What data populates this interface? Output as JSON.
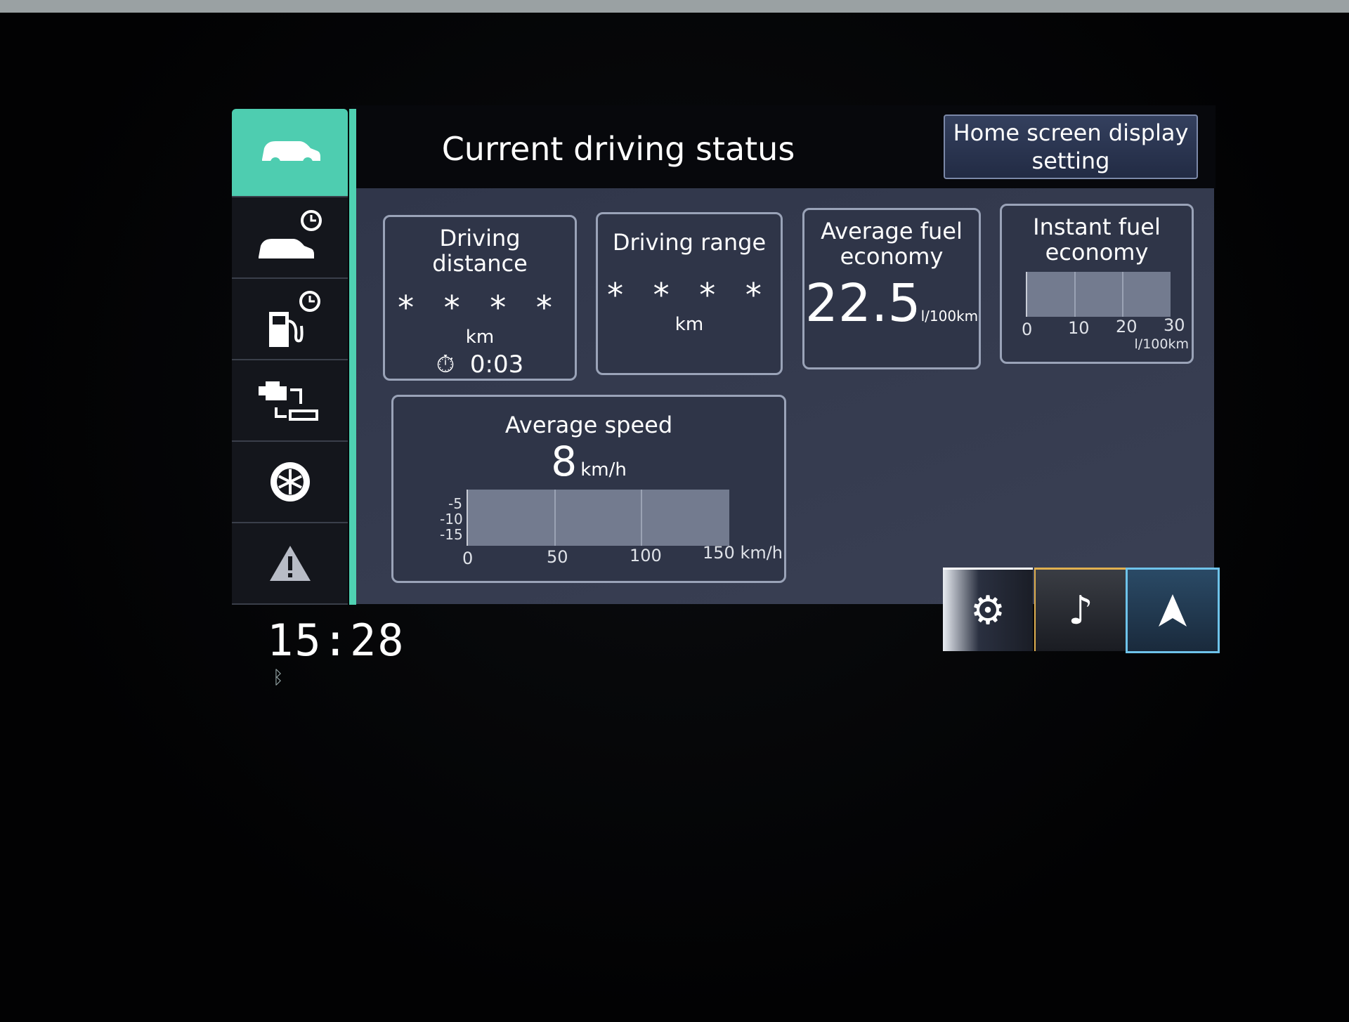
{
  "header": {
    "title": "Current driving status",
    "home_button": "Home screen display setting"
  },
  "sidebar": {
    "items": [
      {
        "icon": "car-icon",
        "active": true
      },
      {
        "icon": "car-history-icon"
      },
      {
        "icon": "fuel-history-icon"
      },
      {
        "icon": "engine-diagnostics-icon"
      },
      {
        "icon": "tire-icon"
      },
      {
        "icon": "warning-icon"
      }
    ]
  },
  "cards": {
    "driving_distance": {
      "title": "Driving distance",
      "value": "* * * *",
      "unit": "km",
      "time": "0:03"
    },
    "driving_range": {
      "title": "Driving range",
      "value": "* * * *",
      "unit": "km"
    },
    "average_fuel": {
      "title": "Average fuel economy",
      "value": "22.5",
      "unit": "l/100km"
    },
    "instant_fuel": {
      "title": "Instant fuel economy",
      "ticks": [
        "0",
        "10",
        "20",
        "30"
      ],
      "unit": "l/100km"
    },
    "average_speed": {
      "title": "Average speed",
      "value": "8",
      "unit": "km/h",
      "y_ticks": [
        "-5",
        "-10",
        "-15"
      ],
      "x_ticks": [
        "0",
        "50",
        "100",
        "150 km/h"
      ]
    }
  },
  "bottom_buttons": [
    {
      "icon": "settings-gear-icon",
      "accent": "#ffffff"
    },
    {
      "icon": "music-note-icon",
      "accent": "#e0b050"
    },
    {
      "icon": "navigation-arrow-icon",
      "accent": "#6ec3ea"
    }
  ],
  "status": {
    "clock": "15:28",
    "bluetooth_icon": "bluetooth-icon"
  },
  "colors": {
    "accent": "#4ecdb0",
    "panel": "#353b4f"
  }
}
